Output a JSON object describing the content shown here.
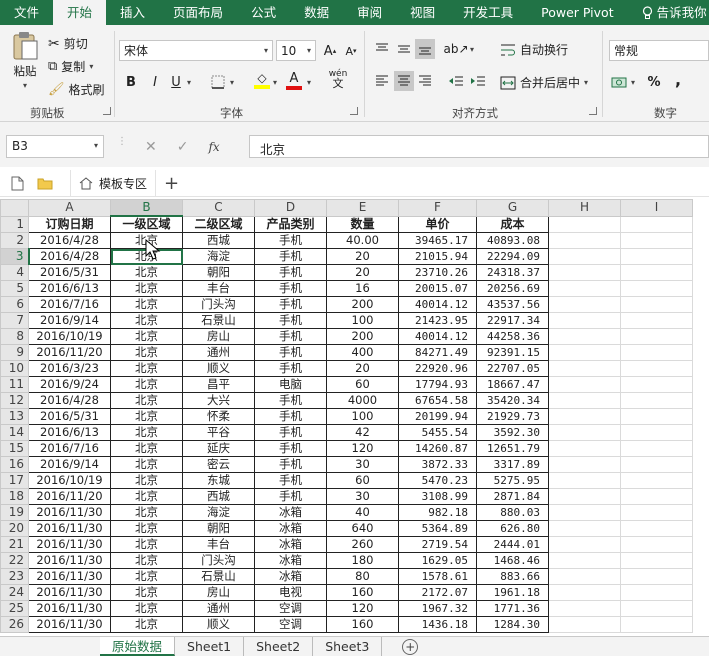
{
  "ribbon_tabs": [
    "文件",
    "开始",
    "插入",
    "页面布局",
    "公式",
    "数据",
    "审阅",
    "视图",
    "开发工具",
    "Power Pivot"
  ],
  "active_tab": "开始",
  "tell_me": "告诉我你",
  "clipboard": {
    "paste": "粘贴",
    "cut": "剪切",
    "copy": "复制",
    "format_painter": "格式刷",
    "group": "剪贴板"
  },
  "font": {
    "name": "宋体",
    "size": "10",
    "bold": "B",
    "italic": "I",
    "underline": "U",
    "group": "字体",
    "pinyin": "wén"
  },
  "alignment": {
    "wrap": "自动换行",
    "merge": "合并后居中",
    "group": "对齐方式"
  },
  "number": {
    "format": "常规",
    "percent": "%",
    "comma": ",",
    "group": "数字"
  },
  "formula_bar": {
    "name_box": "B3",
    "fx": "fx",
    "value": "北京"
  },
  "template_bar": {
    "tab_label": "模板专区"
  },
  "columns": [
    "A",
    "B",
    "C",
    "D",
    "E",
    "F",
    "G",
    "H",
    "I"
  ],
  "selected_column": "B",
  "selected_row": 3,
  "headers": [
    "订购日期",
    "一级区域",
    "二级区域",
    "产品类别",
    "数量",
    "单价",
    "成本"
  ],
  "rows": [
    [
      "2016/4/28",
      "北京",
      "西城",
      "手机",
      "40.00",
      "39465.17",
      "40893.08"
    ],
    [
      "2016/4/28",
      "北京",
      "海淀",
      "手机",
      "20",
      "21015.94",
      "22294.09"
    ],
    [
      "2016/5/31",
      "北京",
      "朝阳",
      "手机",
      "20",
      "23710.26",
      "24318.37"
    ],
    [
      "2016/6/13",
      "北京",
      "丰台",
      "手机",
      "16",
      "20015.07",
      "20256.69"
    ],
    [
      "2016/7/16",
      "北京",
      "门头沟",
      "手机",
      "200",
      "40014.12",
      "43537.56"
    ],
    [
      "2016/9/14",
      "北京",
      "石景山",
      "手机",
      "100",
      "21423.95",
      "22917.34"
    ],
    [
      "2016/10/19",
      "北京",
      "房山",
      "手机",
      "200",
      "40014.12",
      "44258.36"
    ],
    [
      "2016/11/20",
      "北京",
      "通州",
      "手机",
      "400",
      "84271.49",
      "92391.15"
    ],
    [
      "2016/3/23",
      "北京",
      "顺义",
      "手机",
      "20",
      "22920.96",
      "22707.05"
    ],
    [
      "2016/9/24",
      "北京",
      "昌平",
      "电脑",
      "60",
      "17794.93",
      "18667.47"
    ],
    [
      "2016/4/28",
      "北京",
      "大兴",
      "手机",
      "4000",
      "67654.58",
      "35420.34"
    ],
    [
      "2016/5/31",
      "北京",
      "怀柔",
      "手机",
      "100",
      "20199.94",
      "21929.73"
    ],
    [
      "2016/6/13",
      "北京",
      "平谷",
      "手机",
      "42",
      "5455.54",
      "3592.30"
    ],
    [
      "2016/7/16",
      "北京",
      "延庆",
      "手机",
      "120",
      "14260.87",
      "12651.79"
    ],
    [
      "2016/9/14",
      "北京",
      "密云",
      "手机",
      "30",
      "3872.33",
      "3317.89"
    ],
    [
      "2016/10/19",
      "北京",
      "东城",
      "手机",
      "60",
      "5470.23",
      "5275.95"
    ],
    [
      "2016/11/20",
      "北京",
      "西城",
      "手机",
      "30",
      "3108.99",
      "2871.84"
    ],
    [
      "2016/11/30",
      "北京",
      "海淀",
      "冰箱",
      "40",
      "982.18",
      "880.03"
    ],
    [
      "2016/11/30",
      "北京",
      "朝阳",
      "冰箱",
      "640",
      "5364.89",
      "626.80"
    ],
    [
      "2016/11/30",
      "北京",
      "丰台",
      "冰箱",
      "260",
      "2719.54",
      "2444.01"
    ],
    [
      "2016/11/30",
      "北京",
      "门头沟",
      "冰箱",
      "180",
      "1629.05",
      "1468.46"
    ],
    [
      "2016/11/30",
      "北京",
      "石景山",
      "冰箱",
      "80",
      "1578.61",
      "883.66"
    ],
    [
      "2016/11/30",
      "北京",
      "房山",
      "电视",
      "160",
      "2172.07",
      "1961.18"
    ],
    [
      "2016/11/30",
      "北京",
      "通州",
      "空调",
      "120",
      "1967.32",
      "1771.36"
    ],
    [
      "2016/11/30",
      "北京",
      "顺义",
      "空调",
      "160",
      "1436.18",
      "1284.30"
    ]
  ],
  "sheet_tabs": [
    "原始数据",
    "Sheet1",
    "Sheet2",
    "Sheet3"
  ],
  "active_sheet": "原始数据",
  "colors": {
    "excel_green": "#217346",
    "ribbon_bg": "#f3f3f3"
  }
}
